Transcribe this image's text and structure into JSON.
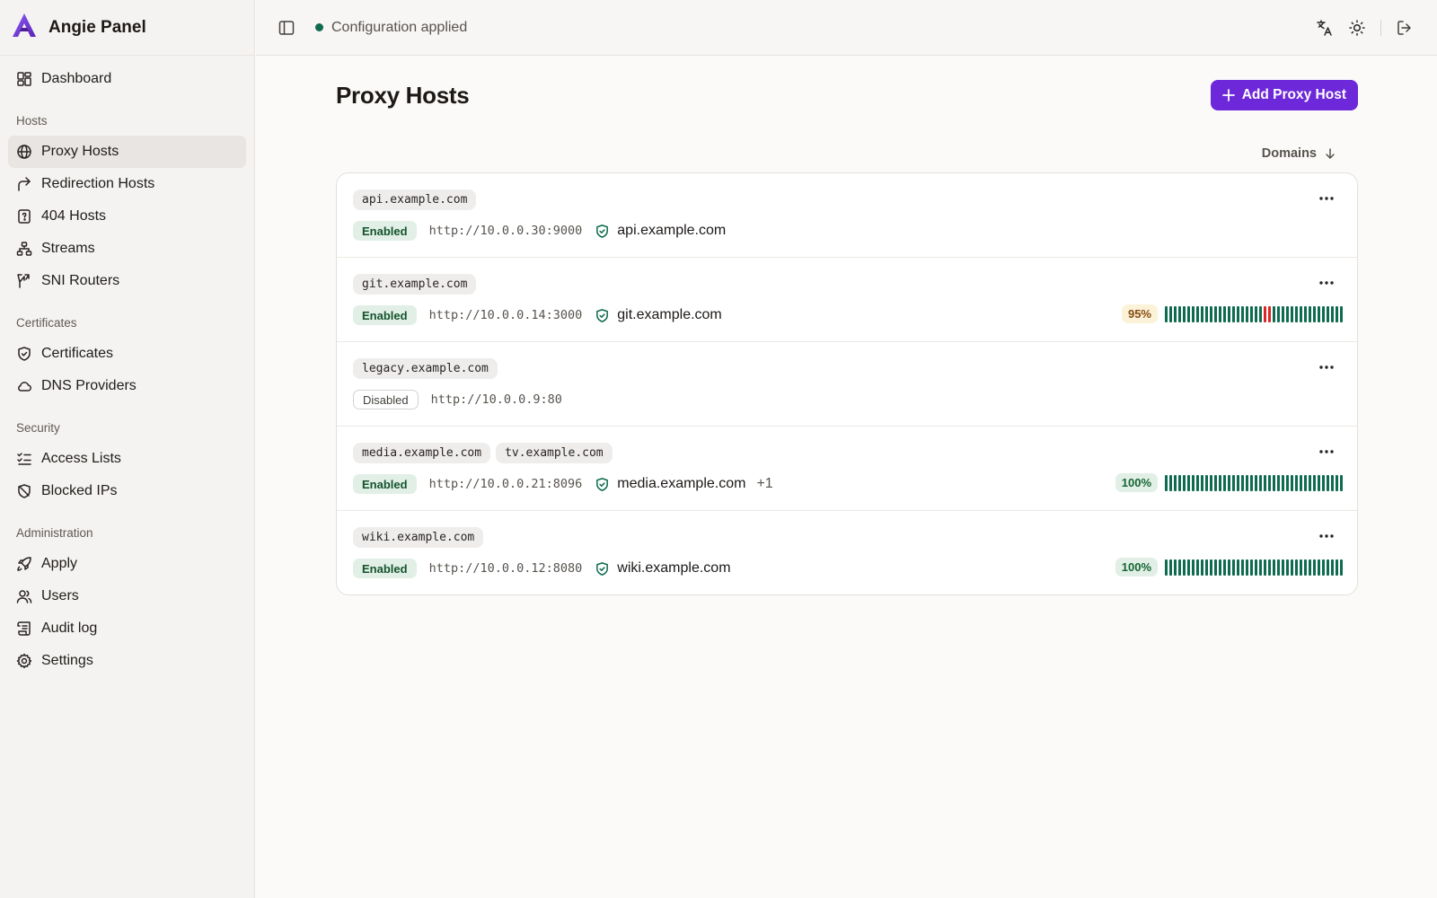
{
  "app": {
    "name": "Angie Panel"
  },
  "sidebar": {
    "dashboard": "Dashboard",
    "groups": {
      "hosts": "Hosts",
      "certificates": "Certificates",
      "security": "Security",
      "administration": "Administration"
    },
    "items": {
      "proxy_hosts": "Proxy Hosts",
      "redirection_hosts": "Redirection Hosts",
      "hosts_404": "404 Hosts",
      "streams": "Streams",
      "sni_routers": "SNI Routers",
      "certificates": "Certificates",
      "dns_providers": "DNS Providers",
      "access_lists": "Access Lists",
      "blocked_ips": "Blocked IPs",
      "apply": "Apply",
      "users": "Users",
      "audit_log": "Audit log",
      "settings": "Settings"
    },
    "active": "proxy_hosts"
  },
  "topbar": {
    "status_text": "Configuration applied",
    "status_color": "#0f6b4f"
  },
  "main": {
    "title": "Proxy Hosts",
    "add_button": "Add Proxy Host",
    "sort_label": "Domains",
    "accent_color": "#6d28d9"
  },
  "hosts": [
    {
      "domains": [
        "api.example.com"
      ],
      "status": "Enabled",
      "upstream": "http://10.0.0.30:9000",
      "cert": "api.example.com",
      "cert_extra": ""
    },
    {
      "domains": [
        "git.example.com"
      ],
      "status": "Enabled",
      "upstream": "http://10.0.0.14:3000",
      "cert": "git.example.com",
      "cert_extra": "",
      "uptime": "95%",
      "uptime_level": "warn",
      "uptime_beats": [
        1,
        1,
        1,
        1,
        1,
        1,
        1,
        1,
        1,
        1,
        1,
        1,
        1,
        1,
        1,
        1,
        1,
        1,
        1,
        1,
        1,
        1,
        0,
        0,
        1,
        1,
        1,
        1,
        1,
        1,
        1,
        1,
        1,
        1,
        1,
        1,
        1,
        1,
        1,
        1
      ]
    },
    {
      "domains": [
        "legacy.example.com"
      ],
      "status": "Disabled",
      "upstream": "http://10.0.0.9:80"
    },
    {
      "domains": [
        "media.example.com",
        "tv.example.com"
      ],
      "status": "Enabled",
      "upstream": "http://10.0.0.21:8096",
      "cert": "media.example.com",
      "cert_extra": "+1",
      "uptime": "100%",
      "uptime_level": "good",
      "uptime_beats": [
        1,
        1,
        1,
        1,
        1,
        1,
        1,
        1,
        1,
        1,
        1,
        1,
        1,
        1,
        1,
        1,
        1,
        1,
        1,
        1,
        1,
        1,
        1,
        1,
        1,
        1,
        1,
        1,
        1,
        1,
        1,
        1,
        1,
        1,
        1,
        1,
        1,
        1,
        1,
        1
      ]
    },
    {
      "domains": [
        "wiki.example.com"
      ],
      "status": "Enabled",
      "upstream": "http://10.0.0.12:8080",
      "cert": "wiki.example.com",
      "cert_extra": "",
      "uptime": "100%",
      "uptime_level": "good",
      "uptime_beats": [
        1,
        1,
        1,
        1,
        1,
        1,
        1,
        1,
        1,
        1,
        1,
        1,
        1,
        1,
        1,
        1,
        1,
        1,
        1,
        1,
        1,
        1,
        1,
        1,
        1,
        1,
        1,
        1,
        1,
        1,
        1,
        1,
        1,
        1,
        1,
        1,
        1,
        1,
        1,
        1
      ]
    }
  ]
}
